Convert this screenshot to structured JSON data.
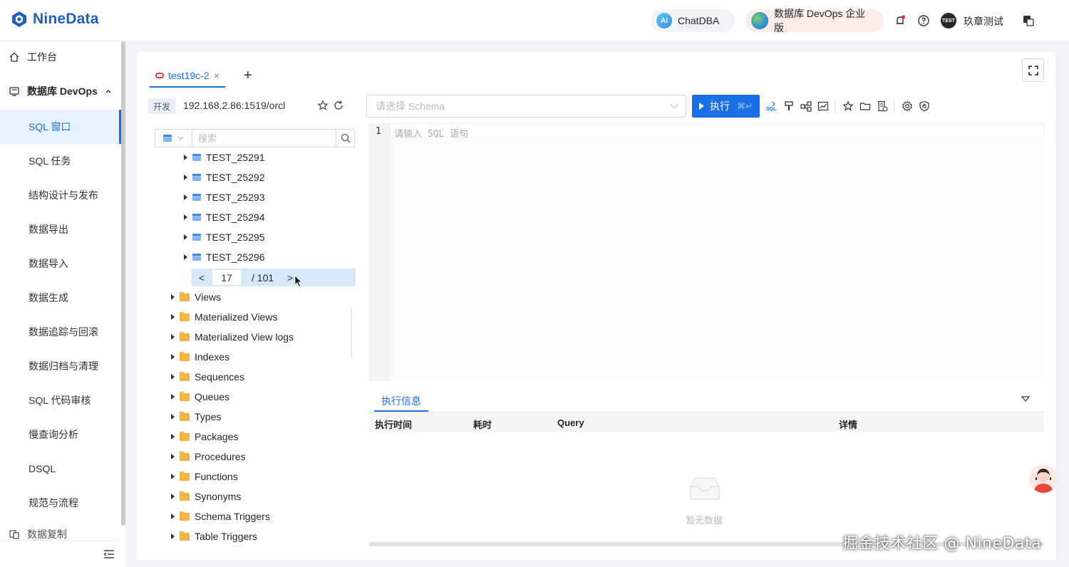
{
  "header": {
    "logo_text": "NineData",
    "chatdba_label": "ChatDBA",
    "chatdba_badge": "AI",
    "edition_label": "数据库 DevOps 企业版",
    "user_avatar_text": "TEST",
    "user_name": "玖章测试"
  },
  "sidebar": {
    "workbench": "工作台",
    "devops_group": "数据库 DevOps",
    "items": [
      {
        "label": "SQL 窗口",
        "active": true
      },
      {
        "label": "SQL 任务"
      },
      {
        "label": "结构设计与发布"
      },
      {
        "label": "数据导出"
      },
      {
        "label": "数据导入"
      },
      {
        "label": "数据生成"
      },
      {
        "label": "数据追踪与回滚"
      },
      {
        "label": "数据归档与清理"
      },
      {
        "label": "SQL 代码审核"
      },
      {
        "label": "慢查询分析"
      },
      {
        "label": "DSQL"
      },
      {
        "label": "规范与流程"
      }
    ],
    "next_group": "数据复制"
  },
  "tab": {
    "label": "test19c-2",
    "close_symbol": "×",
    "add_symbol": "+"
  },
  "connection": {
    "env_tag": "开发",
    "address": "192.168.2.86:1519/orcl"
  },
  "tree": {
    "search_placeholder": "搜索",
    "tables": [
      "TEST_25291",
      "TEST_25292",
      "TEST_25293",
      "TEST_25294",
      "TEST_25295",
      "TEST_25296"
    ],
    "pager": {
      "prev": "<",
      "current": "17",
      "total": "/ 101",
      "next": ">"
    },
    "folders": [
      "Views",
      "Materialized Views",
      "Materialized View logs",
      "Indexes",
      "Sequences",
      "Queues",
      "Types",
      "Packages",
      "Procedures",
      "Functions",
      "Synonyms",
      "Schema Triggers",
      "Table Triggers"
    ]
  },
  "editor": {
    "schema_placeholder": "请选择 Schema",
    "run_label": "执行",
    "run_shortcut": "⌘↵",
    "line_number": "1",
    "placeholder": "请输入 SQL 语句"
  },
  "results": {
    "tab_label": "执行信息",
    "columns": [
      "执行时间",
      "耗时",
      "Query",
      "详情"
    ],
    "empty_text": "暂无数据"
  },
  "watermark": "掘金技术社区 @ NineData",
  "colors": {
    "primary": "#1a6fe6",
    "brand": "#1f5fbf",
    "oracle": "#d9363e"
  }
}
